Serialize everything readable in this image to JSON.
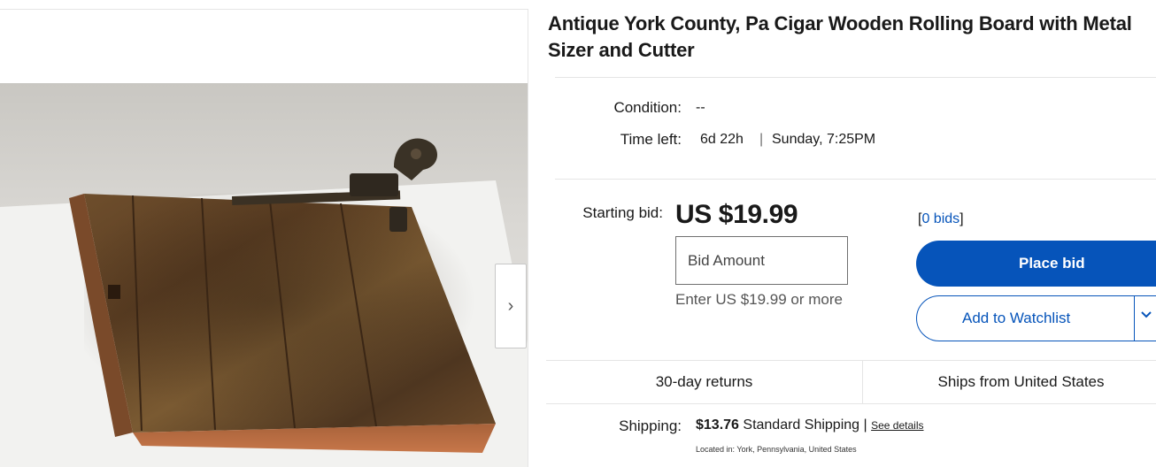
{
  "listing": {
    "title": "Antique York County, Pa Cigar Wooden Rolling Board with Metal Sizer and Cutter"
  },
  "gallery": {
    "next_icon": "chevron-right-icon",
    "next_glyph": "›"
  },
  "details": {
    "condition_label": "Condition:",
    "condition_value": "--",
    "time_left_label": "Time left:",
    "time_left_value": "6d 22h",
    "time_separator": "|",
    "end_time": "Sunday, 7:25PM"
  },
  "bidding": {
    "starting_bid_label": "Starting bid:",
    "price": "US $19.99",
    "bids_open": "[",
    "bids_link": "0 bids",
    "bids_close": "]",
    "bid_amount_placeholder": "Bid Amount",
    "hint": "Enter US $19.99 or more",
    "place_bid_label": "Place bid",
    "watchlist_label": "Add to Watchlist",
    "watchlist_menu_icon": "chevron-down-icon"
  },
  "features": {
    "returns": "30-day returns",
    "ships_from": "Ships from United States"
  },
  "shipping": {
    "label": "Shipping:",
    "cost": "$13.76",
    "method": "Standard Shipping",
    "separator": "|",
    "details_link": "See details",
    "located_label": "Located in:",
    "located_value": "York, Pennsylvania, United States"
  },
  "colors": {
    "accent": "#0654ba",
    "border": "#e5e5e5",
    "text": "#191919"
  }
}
